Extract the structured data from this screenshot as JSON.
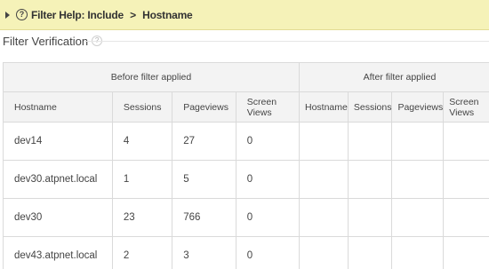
{
  "help_bar": {
    "label": "Filter Help: Include",
    "separator": ">",
    "field": "Hostname"
  },
  "section": {
    "title": "Filter Verification"
  },
  "table": {
    "before_group": "Before filter applied",
    "after_group": "After filter applied",
    "before_columns": [
      "Hostname",
      "Sessions",
      "Pageviews",
      "Screen Views"
    ],
    "after_columns": [
      "Hostname",
      "Sessions",
      "Pageviews",
      "Screen Views"
    ],
    "rows": [
      {
        "hostname": "dev14",
        "sessions": "4",
        "pageviews": "27",
        "screen_views": "0"
      },
      {
        "hostname": "dev30.atpnet.local",
        "sessions": "1",
        "pageviews": "5",
        "screen_views": "0"
      },
      {
        "hostname": "dev30",
        "sessions": "23",
        "pageviews": "766",
        "screen_views": "0"
      },
      {
        "hostname": "dev43.atpnet.local",
        "sessions": "2",
        "pageviews": "3",
        "screen_views": "0"
      }
    ]
  }
}
